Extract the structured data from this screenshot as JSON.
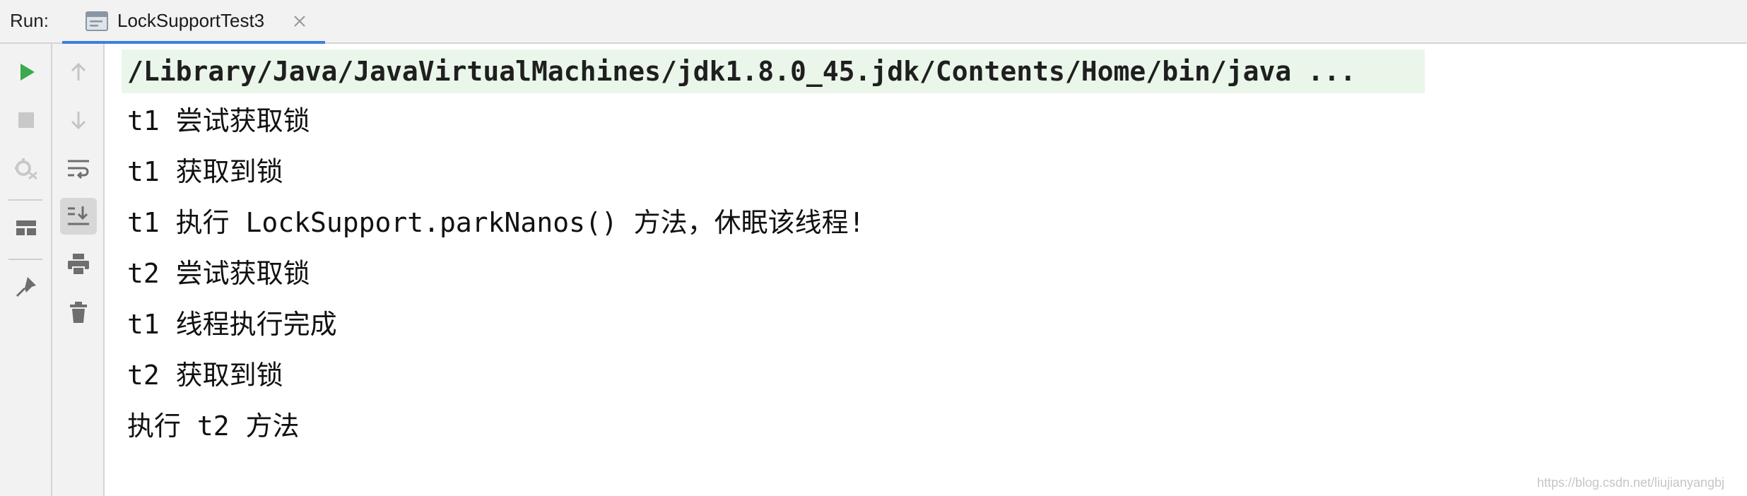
{
  "run_panel": {
    "label": "Run:",
    "tab": {
      "title": "LockSupportTest3",
      "icon": "console-window-icon"
    }
  },
  "toolbar": {
    "left": [
      {
        "name": "rerun",
        "icon": "play-icon",
        "color": "#3ba94c"
      },
      {
        "name": "stop",
        "icon": "stop-icon",
        "color": "#c4c4c4"
      },
      {
        "name": "exit",
        "icon": "debug-exit-icon",
        "color": "#c4c4c4"
      },
      {
        "name": "layout",
        "icon": "layout-icon",
        "color": "#6e6e6e"
      },
      {
        "name": "pin",
        "icon": "pin-icon",
        "color": "#6e6e6e"
      }
    ],
    "right": [
      {
        "name": "up",
        "icon": "arrow-up-icon",
        "color": "#c4c4c4"
      },
      {
        "name": "down",
        "icon": "arrow-down-icon",
        "color": "#c4c4c4"
      },
      {
        "name": "soft-wrap",
        "icon": "soft-wrap-icon",
        "color": "#6e6e6e"
      },
      {
        "name": "scroll-to-end",
        "icon": "scroll-to-end-icon",
        "color": "#6e6e6e",
        "active": true
      },
      {
        "name": "print",
        "icon": "print-icon",
        "color": "#6e6e6e"
      },
      {
        "name": "clear",
        "icon": "trash-icon",
        "color": "#6e6e6e"
      }
    ]
  },
  "console": {
    "command": "/Library/Java/JavaVirtualMachines/jdk1.8.0_45.jdk/Contents/Home/bin/java ...",
    "lines": [
      "t1 尝试获取锁",
      "t1 获取到锁",
      "t1 执行 LockSupport.parkNanos() 方法，休眠该线程!",
      "t2 尝试获取锁",
      "t1 线程执行完成",
      "t2 获取到锁",
      "执行 t2 方法"
    ]
  },
  "watermark": "https://blog.csdn.net/liujianyangbj",
  "colors": {
    "accent": "#3d7fe0",
    "command_bg": "#eaf6ea",
    "run_green": "#3ba94c"
  }
}
